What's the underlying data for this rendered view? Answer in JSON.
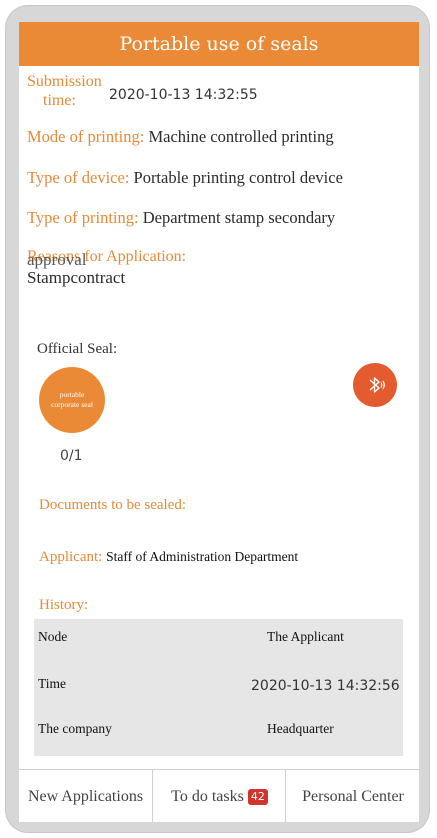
{
  "header": {
    "title": "Portable use of seals"
  },
  "submission": {
    "label_line1": "Submission",
    "label_line2": "time:",
    "value": "2020-10-13 14:32:55"
  },
  "mode_of_printing": {
    "label": "Mode of printing:",
    "value": "Machine controlled printing"
  },
  "type_of_device": {
    "label": "Type of device:",
    "value": "Portable printing control device"
  },
  "type_of_printing": {
    "label": "Type of printing:",
    "value": "Department stamp secondary"
  },
  "reason": {
    "label": "Reasons for Application:",
    "overlap_text": "approval",
    "value": "Stampcontract"
  },
  "seal": {
    "title": "Official Seal:",
    "circle_label": "portable corporate seal",
    "count": "0/1",
    "accent": "#ea8a37"
  },
  "bluetooth": {
    "icon": "bluetooth-icon",
    "color": "#e35b2f"
  },
  "documents": {
    "label": "Documents to be sealed:"
  },
  "applicant": {
    "label": "Applicant:",
    "value": "Staff of Administration Department"
  },
  "history": {
    "label": "History:",
    "rows": [
      {
        "key": "Node",
        "value": "The Applicant"
      },
      {
        "key": "Time",
        "value": "2020-10-13 14:32:56"
      },
      {
        "key": "The company",
        "value": "Headquarter"
      }
    ]
  },
  "tabs": [
    {
      "label": "New Applications"
    },
    {
      "label": "To do tasks",
      "badge": "42"
    },
    {
      "label": "Personal Center"
    }
  ]
}
